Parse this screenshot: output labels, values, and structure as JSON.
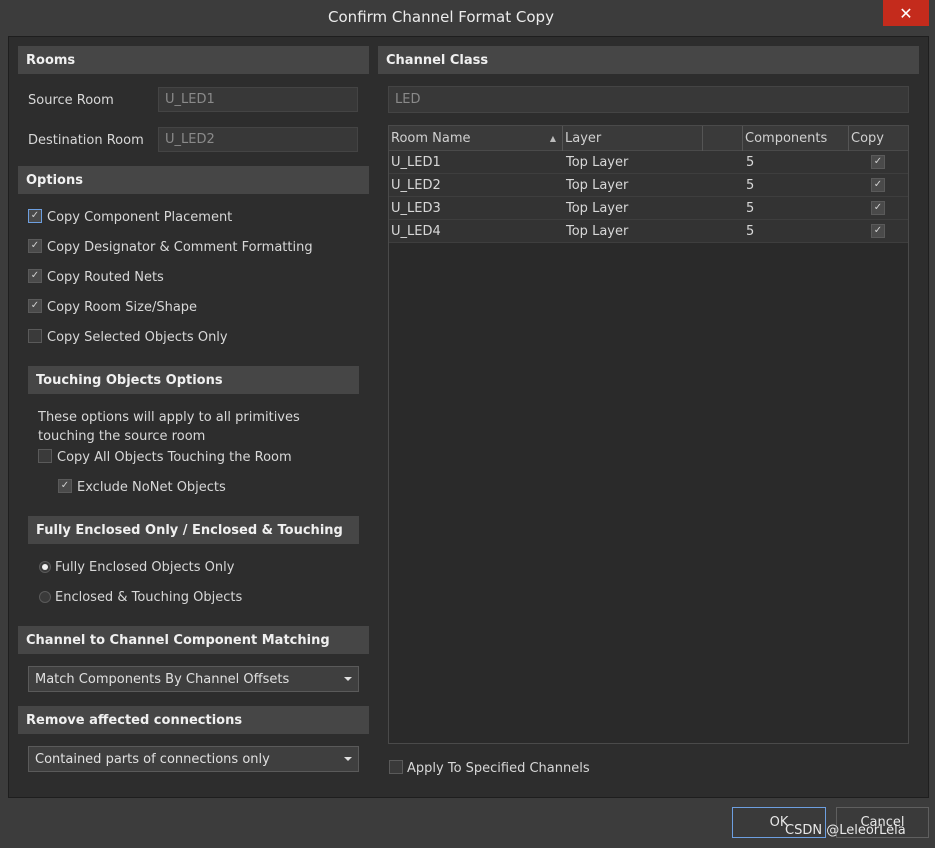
{
  "window": {
    "title": "Confirm Channel Format Copy",
    "close_glyph": "✕"
  },
  "rooms": {
    "header": "Rooms",
    "source_label": "Source Room",
    "source_value": "U_LED1",
    "destination_label": "Destination Room",
    "destination_value": "U_LED2"
  },
  "options": {
    "header": "Options",
    "items": [
      {
        "label": "Copy Component Placement",
        "checked": true
      },
      {
        "label": "Copy Designator & Comment Formatting",
        "checked": true
      },
      {
        "label": "Copy Routed Nets",
        "checked": true
      },
      {
        "label": "Copy Room Size/Shape",
        "checked": true
      },
      {
        "label": "Copy Selected Objects Only",
        "checked": false
      }
    ]
  },
  "touching": {
    "header": "Touching Objects Options",
    "description": "These options will apply to all primitives touching the source room",
    "copy_all_label": "Copy All Objects Touching the Room",
    "copy_all_checked": false,
    "exclude_label": "Exclude NoNet Objects",
    "exclude_checked": true
  },
  "enclosed": {
    "header": "Fully Enclosed Only / Enclosed & Touching",
    "options": [
      {
        "label": "Fully Enclosed Objects Only",
        "selected": true
      },
      {
        "label": "Enclosed & Touching Objects",
        "selected": false
      }
    ]
  },
  "matching": {
    "header": "Channel to Channel Component Matching",
    "selected": "Match Components By Channel Offsets"
  },
  "remove": {
    "header": "Remove affected connections",
    "selected": "Contained parts of connections only"
  },
  "channel_class": {
    "header": "Channel Class",
    "value": "LED"
  },
  "table": {
    "columns": [
      "Room Name",
      "Layer",
      "",
      "Components",
      "Copy"
    ],
    "rows": [
      {
        "room": "U_LED1",
        "layer": "Top Layer",
        "components": "5",
        "copy": true
      },
      {
        "room": "U_LED2",
        "layer": "Top Layer",
        "components": "5",
        "copy": true
      },
      {
        "room": "U_LED3",
        "layer": "Top Layer",
        "components": "5",
        "copy": true
      },
      {
        "room": "U_LED4",
        "layer": "Top Layer",
        "components": "5",
        "copy": true
      }
    ]
  },
  "apply_specified": {
    "label": "Apply To Specified Channels",
    "checked": false
  },
  "buttons": {
    "ok": "OK",
    "cancel": "Cancel"
  },
  "watermark": "CSDN @LeleorLela",
  "glyphs": {
    "check": "✓",
    "sort_up": "▲"
  },
  "colors": {
    "close_button": "#c42b1c",
    "section_header": "#464646",
    "focus_border": "#6d9fe0"
  }
}
